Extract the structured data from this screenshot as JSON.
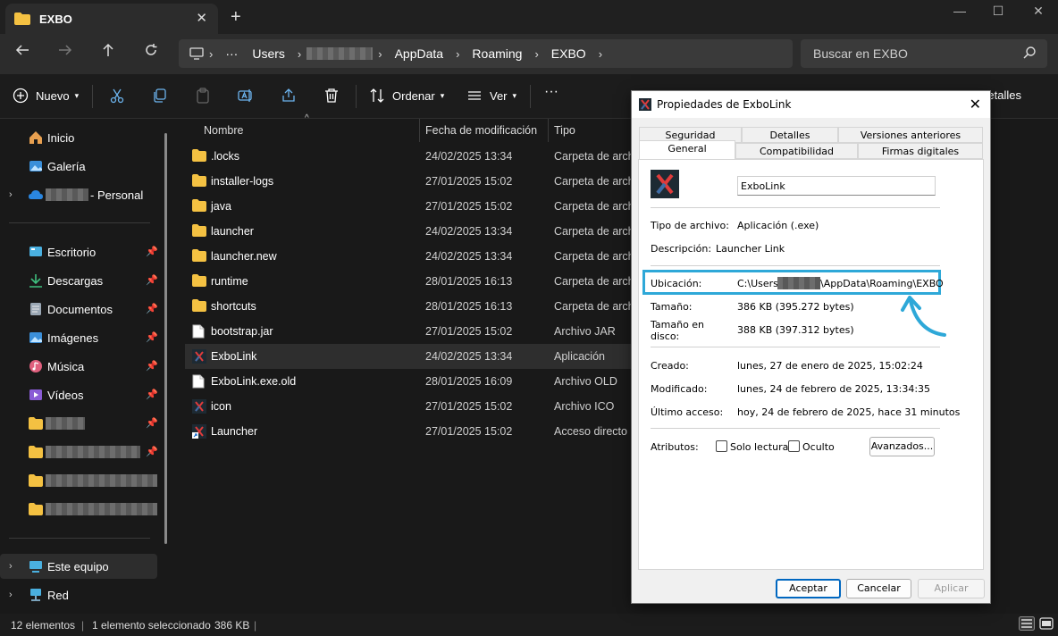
{
  "window": {
    "tab_title": "EXBO",
    "close_tab": "✕",
    "new_tab": "+",
    "minimize": "—",
    "maximize": "☐",
    "close": "✕"
  },
  "address_bar": {
    "crumbs": [
      "Users",
      "AppData",
      "Roaming",
      "EXBO"
    ],
    "more": "···",
    "search_placeholder": "Buscar en EXBO"
  },
  "command_bar": {
    "new_label": "Nuevo",
    "sort_label": "Ordenar",
    "view_label": "Ver",
    "more": "···",
    "details_label": "Detalles"
  },
  "sidebar": {
    "items": [
      {
        "label": "Inicio",
        "icon": "home-icon"
      },
      {
        "label": "Galería",
        "icon": "gallery-icon"
      },
      {
        "label": "- Personal",
        "icon": "onedrive-icon"
      },
      {
        "label": "Escritorio",
        "icon": "desktop-icon"
      },
      {
        "label": "Descargas",
        "icon": "download-icon"
      },
      {
        "label": "Documentos",
        "icon": "documents-icon"
      },
      {
        "label": "Imágenes",
        "icon": "pictures-icon"
      },
      {
        "label": "Música",
        "icon": "music-icon"
      },
      {
        "label": "Vídeos",
        "icon": "videos-icon"
      },
      {
        "label": "Este equipo",
        "icon": "computer-icon"
      },
      {
        "label": "Red",
        "icon": "network-icon"
      }
    ]
  },
  "file_list": {
    "columns": [
      "Nombre",
      "Fecha de modificación",
      "Tipo"
    ],
    "rows": [
      {
        "name": ".locks",
        "date": "24/02/2025 13:34",
        "type": "Carpeta de archivos",
        "icon": "folder-icon"
      },
      {
        "name": "installer-logs",
        "date": "27/01/2025 15:02",
        "type": "Carpeta de archivos",
        "icon": "folder-icon"
      },
      {
        "name": "java",
        "date": "27/01/2025 15:02",
        "type": "Carpeta de archivos",
        "icon": "folder-icon"
      },
      {
        "name": "launcher",
        "date": "24/02/2025 13:34",
        "type": "Carpeta de archivos",
        "icon": "folder-icon"
      },
      {
        "name": "launcher.new",
        "date": "24/02/2025 13:34",
        "type": "Carpeta de archivos",
        "icon": "folder-icon"
      },
      {
        "name": "runtime",
        "date": "28/01/2025 16:13",
        "type": "Carpeta de archivos",
        "icon": "folder-icon"
      },
      {
        "name": "shortcuts",
        "date": "28/01/2025 16:13",
        "type": "Carpeta de archivos",
        "icon": "folder-icon"
      },
      {
        "name": "bootstrap.jar",
        "date": "27/01/2025 15:02",
        "type": "Archivo JAR",
        "icon": "file-icon"
      },
      {
        "name": "ExboLink",
        "date": "24/02/2025 13:34",
        "type": "Aplicación",
        "icon": "exbo-app-icon"
      },
      {
        "name": "ExboLink.exe.old",
        "date": "28/01/2025 16:09",
        "type": "Archivo OLD",
        "icon": "file-icon"
      },
      {
        "name": "icon",
        "date": "27/01/2025 15:02",
        "type": "Archivo ICO",
        "icon": "exbo-app-icon"
      },
      {
        "name": "Launcher",
        "date": "27/01/2025 15:02",
        "type": "Acceso directo",
        "icon": "shortcut-icon"
      }
    ]
  },
  "status_bar": {
    "count": "12 elementos",
    "selected": "1 elemento seleccionado",
    "size": "386 KB"
  },
  "dialog": {
    "title": "Propiedades de ExboLink",
    "tabs_top": [
      "Seguridad",
      "Detalles",
      "Versiones anteriores"
    ],
    "tabs_bottom": [
      "General",
      "Compatibilidad",
      "Firmas digitales"
    ],
    "filename": "ExboLink",
    "file_type_label": "Tipo de archivo:",
    "file_type": "Aplicación (.exe)",
    "description_label": "Descripción:",
    "description": "Launcher Link",
    "location_label": "Ubicación:",
    "location_prefix": "C:\\Users\\",
    "location_suffix": "\\AppData\\Roaming\\EXBO",
    "size_label": "Tamaño:",
    "size": "386 KB (395.272 bytes)",
    "disk_size_label_1": "Tamaño en",
    "disk_size_label_2": "disco:",
    "disk_size": "388 KB (397.312 bytes)",
    "created_label": "Creado:",
    "created": "lunes, 27 de enero de 2025, 15:02:24",
    "modified_label": "Modificado:",
    "modified": "lunes, 24 de febrero de 2025, 13:34:35",
    "accessed_label": "Último acceso:",
    "accessed": "hoy, 24 de febrero de 2025, hace 31 minutos",
    "attributes_label": "Atributos:",
    "readonly_label": "Solo lectura",
    "hidden_label": "Oculto",
    "advanced_button": "Avanzados...",
    "ok_button": "Aceptar",
    "cancel_button": "Cancelar",
    "apply_button": "Aplicar",
    "highlight_color": "#2ea8d8"
  }
}
